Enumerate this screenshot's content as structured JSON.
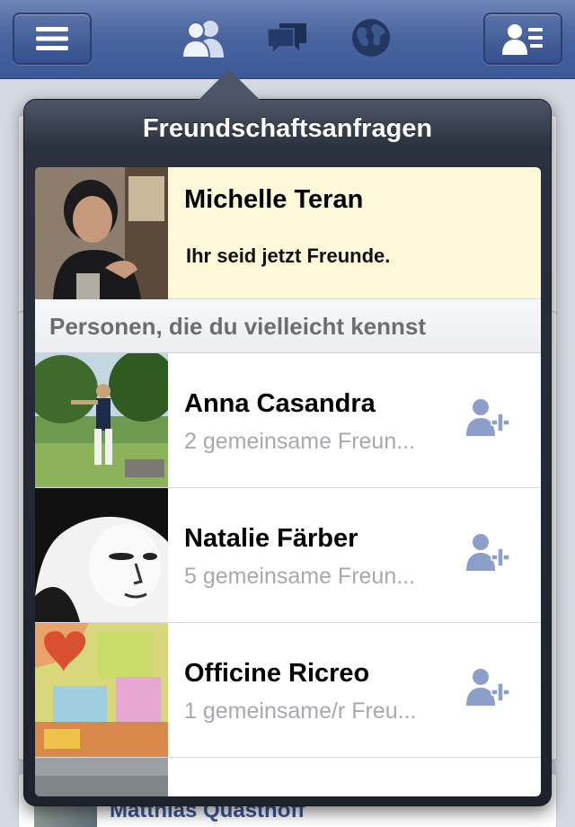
{
  "navbar": {
    "icons": [
      "menu-icon",
      "friend-requests-icon",
      "messages-icon",
      "notifications-globe-icon",
      "contacts-icon"
    ],
    "accent": "#3b5998"
  },
  "background": {
    "visible_name": "Matthias Quasthoff"
  },
  "popover": {
    "title": "Freundschaftsanfragen",
    "accepted": {
      "name": "Michelle Teran",
      "status": "Ihr seid jetzt Freunde."
    },
    "section_header": "Personen, die du vielleicht kennst",
    "suggestions": [
      {
        "name": "Anna Casandra",
        "mutual": "2 gemeinsame Freun..."
      },
      {
        "name": "Natalie Färber",
        "mutual": "5 gemeinsame Freun..."
      },
      {
        "name": "Officine Ricreo",
        "mutual": "1 gemeinsame/r Freu..."
      }
    ]
  }
}
